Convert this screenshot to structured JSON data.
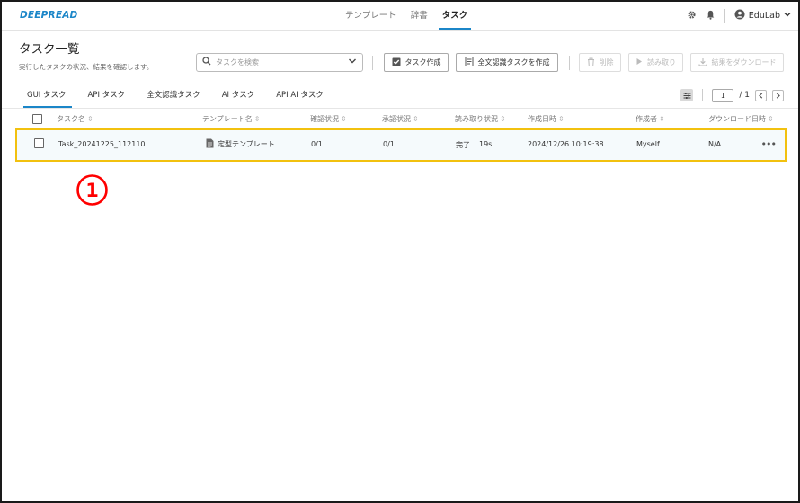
{
  "app": {
    "logo": "DEEPREAD"
  },
  "nav": {
    "tabs": [
      "テンプレート",
      "辞書",
      "タスク"
    ],
    "active_index": 2
  },
  "user": {
    "name": "EduLab"
  },
  "header": {
    "title": "タスク一覧",
    "subtitle": "実行したタスクの状況、結果を確認します。"
  },
  "search": {
    "placeholder": "タスクを検索"
  },
  "toolbar": {
    "create_task": "タスク作成",
    "create_fulltext_task": "全文認識タスクを作成",
    "delete": "削除",
    "read": "読み取り",
    "download": "結果をダウンロード"
  },
  "subtabs": [
    "GUI タスク",
    "API タスク",
    "全文認識タスク",
    "AI タスク",
    "API AI タスク"
  ],
  "pager": {
    "current": "1",
    "total": "/ 1"
  },
  "table": {
    "columns": [
      "タスク名",
      "テンプレート名",
      "確認状況",
      "承認状況",
      "読み取り状況",
      "作成日時",
      "作成者",
      "ダウンロード日時"
    ],
    "rows": [
      {
        "name": "Task_20241225_112110",
        "template": "定型テンプレート",
        "confirm": "0/1",
        "approve": "0/1",
        "read_status": "完了",
        "read_time": "19s",
        "created": "2024/12/26 10:19:38",
        "creator": "Myself",
        "downloaded": "N/A"
      }
    ]
  },
  "annotation": {
    "label": "①",
    "color": "#ff0000"
  },
  "colors": {
    "accent": "#1b86c8",
    "highlight_border": "#f2c10f"
  },
  "icons": [
    "gear-icon",
    "bell-icon",
    "user-circle-icon",
    "chevron-down-icon",
    "search-icon",
    "checkbox-check-icon",
    "document-scan-icon",
    "trash-icon",
    "play-icon",
    "download-icon",
    "filter-icon",
    "document-icon",
    "more-icon",
    "sort-icon"
  ]
}
